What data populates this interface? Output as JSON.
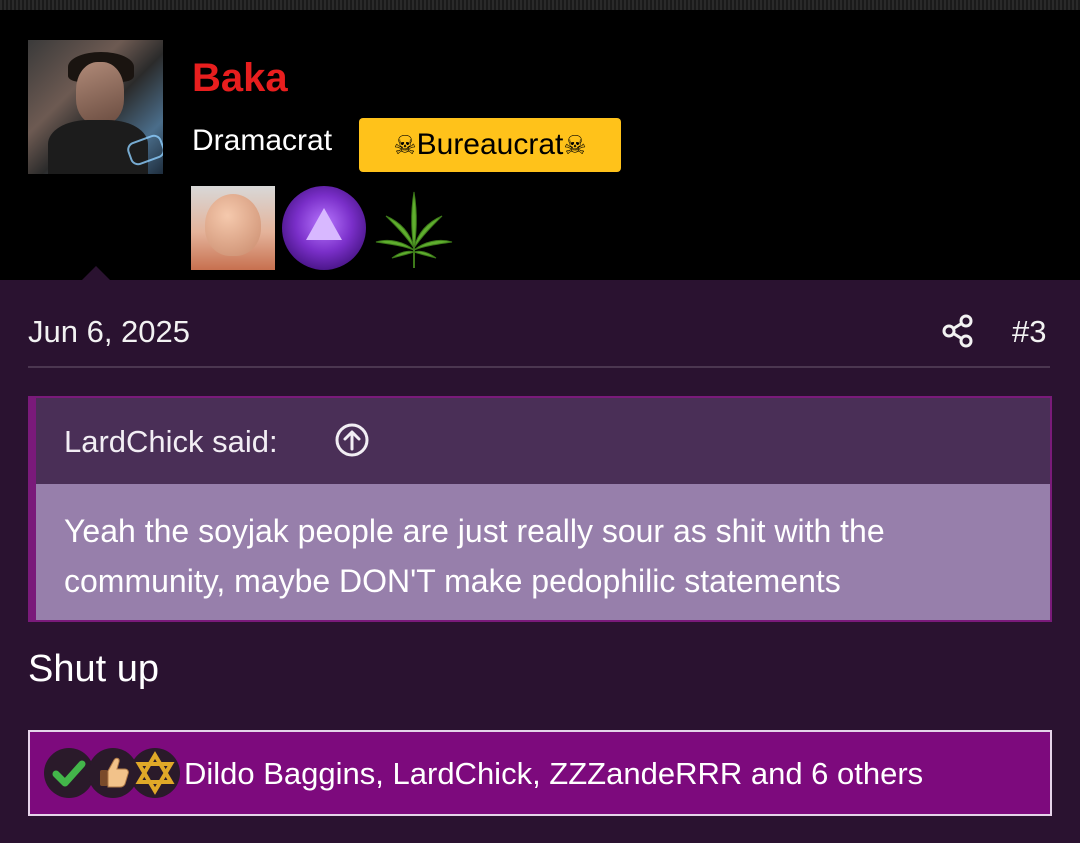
{
  "author": {
    "username": "Baka",
    "user_title": "Dramacrat",
    "role_badge": "Bureaucrat",
    "role_badge_icon": "skull-crossbones-icon",
    "role_badge_color": "#ffc21a",
    "username_color": "#e81e1e",
    "trophies": [
      "bald-man-trophy-icon",
      "purple-triangle-medal-icon",
      "cannabis-leaf-icon"
    ]
  },
  "post": {
    "date": "Jun 6, 2025",
    "number": "#3",
    "share_icon": "share-icon",
    "body": "Shut up"
  },
  "quote": {
    "author": "LardChick said:",
    "jump_icon": "arrow-up-circle-icon",
    "text": "Yeah the soyjak people are just really sour as shit with the community, maybe DON'T make pedophilic statements"
  },
  "reactions": {
    "icons": [
      "checkmark-reaction-icon",
      "thumbs-up-reaction-icon",
      "star-of-david-reaction-icon"
    ],
    "summary": "Dildo Baggins, LardChick, ZZZandeRRR and 6 others"
  },
  "colors": {
    "background": "#2a1230",
    "header": "#000000",
    "quote_head": "#4a2f57",
    "quote_body": "#977fab",
    "reaction_bar": "#7d0a7d"
  }
}
